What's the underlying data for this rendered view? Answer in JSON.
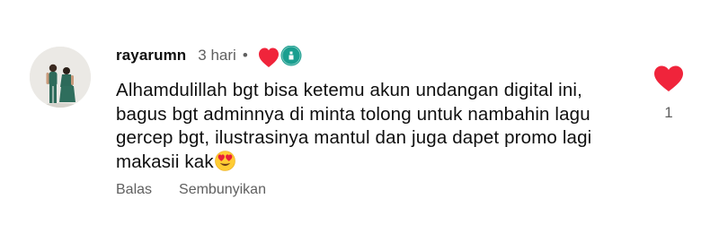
{
  "comment": {
    "author": "rayarumn",
    "time": "3 hari",
    "separator": "•",
    "text": "Alhamdulillah bgt bisa ketemu akun undangan digital ini, bagus bgt adminnya di minta tolong untuk nambahin lagu gercep bgt, ilustrasinya mantul dan juga dapet promo lagi makasii kak",
    "emoji": "smiling-face-with-heart-eyes",
    "like_count": "1",
    "actions": {
      "reply_label": "Balas",
      "hide_label": "Sembunyikan"
    },
    "colors": {
      "heart": "#f0243b",
      "creator_badge": "#1a9e8f",
      "meta_text": "#606060"
    },
    "icons": {
      "like": "heart-icon",
      "creator_heart": "heart-icon",
      "creator_badge": "creator-avatar-badge"
    }
  }
}
